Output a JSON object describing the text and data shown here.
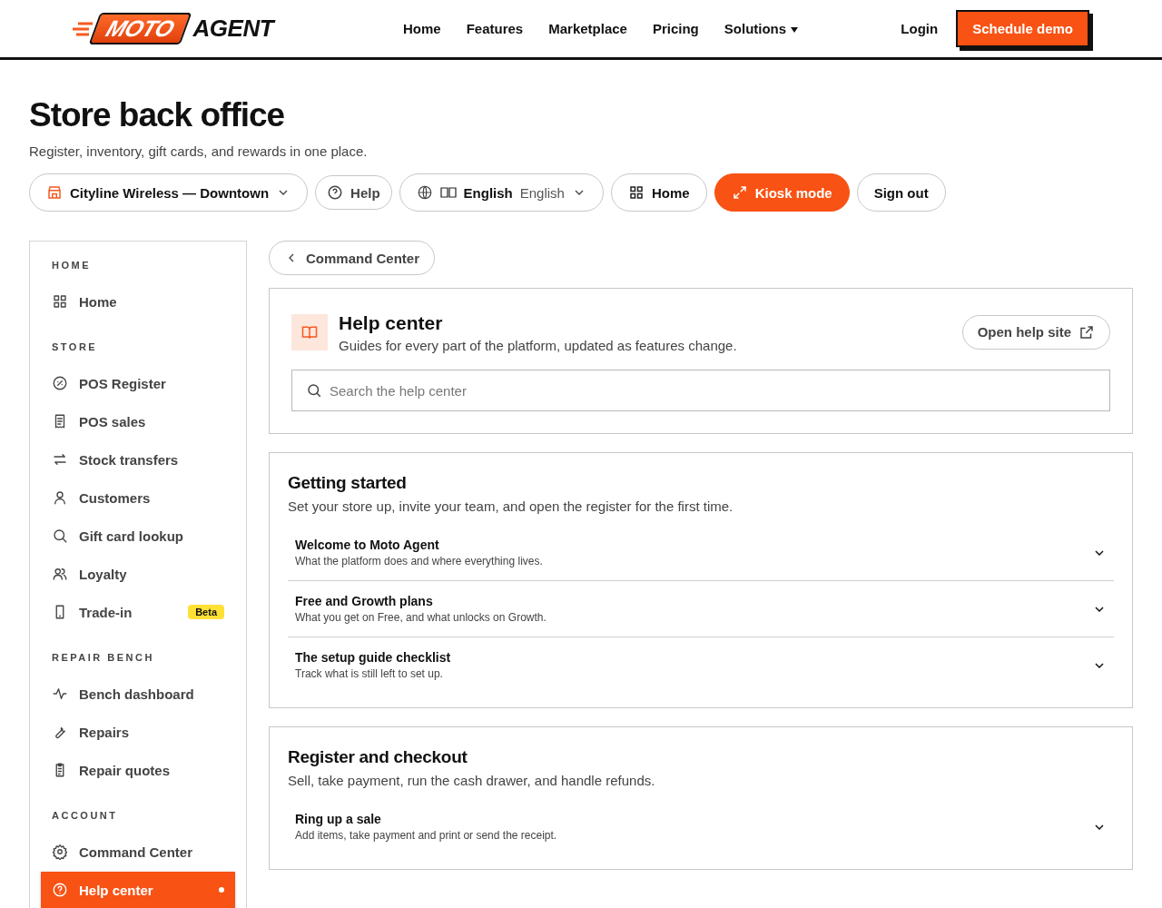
{
  "header": {
    "logo": {
      "word_1": "MOTO",
      "word_2": "AGENT"
    },
    "nav": [
      {
        "label": "Home",
        "dropdown": false
      },
      {
        "label": "Features",
        "dropdown": false
      },
      {
        "label": "Marketplace",
        "dropdown": false
      },
      {
        "label": "Pricing",
        "dropdown": false
      },
      {
        "label": "Solutions",
        "dropdown": true
      }
    ],
    "login": "Login",
    "cta": "Schedule demo"
  },
  "page": {
    "title": "Store back office",
    "subtitle": "Register, inventory, gift cards, and rewards in one place."
  },
  "toolbar": {
    "store": "Cityline Wireless — Downtown",
    "help": "Help",
    "language": {
      "label": "English",
      "native": "English"
    },
    "home": "Home",
    "kiosk": "Kiosk mode",
    "sign_out": "Sign out"
  },
  "sidebar": [
    {
      "heading": "HOME",
      "items": [
        {
          "label": "Home",
          "selected": false
        }
      ]
    },
    {
      "heading": "STORE",
      "items": [
        {
          "label": "POS Register",
          "selected": false
        },
        {
          "label": "POS sales",
          "selected": false
        },
        {
          "label": "Stock transfers",
          "selected": false
        },
        {
          "label": "Customers",
          "selected": false
        },
        {
          "label": "Gift card lookup",
          "selected": false
        },
        {
          "label": "Loyalty",
          "selected": false
        },
        {
          "label": "Trade-in",
          "selected": false,
          "badge": "Beta"
        }
      ]
    },
    {
      "heading": "REPAIR BENCH",
      "items": [
        {
          "label": "Bench dashboard",
          "selected": false
        },
        {
          "label": "Repairs",
          "selected": false
        },
        {
          "label": "Repair quotes",
          "selected": false
        }
      ]
    },
    {
      "heading": "ACCOUNT",
      "items": [
        {
          "label": "Command Center",
          "selected": false
        },
        {
          "label": "Help center",
          "selected": true
        }
      ]
    }
  ],
  "back_link": "Command Center",
  "help_card": {
    "title": "Help center",
    "subtitle": "Guides for every part of the platform, updated as features change.",
    "button": "Open help site",
    "search_placeholder": "Search the help center"
  },
  "sections": [
    {
      "title": "Getting started",
      "subtitle": "Set your store up, invite your team, and open the register for the first time.",
      "items": [
        {
          "title": "Welcome to Moto Agent",
          "description": "What the platform does and where everything lives.",
          "expanded": false
        },
        {
          "title": "Free and Growth plans",
          "description": "What you get on Free, and what unlocks on Growth.",
          "expanded": false
        },
        {
          "title": "The setup guide checklist",
          "description": "Track what is still left to set up.",
          "expanded": false
        }
      ]
    },
    {
      "title": "Register and checkout",
      "subtitle": "Sell, take payment, run the cash drawer, and handle refunds.",
      "items": [
        {
          "title": "Ring up a sale",
          "description": "Add items, take payment and print or send the receipt.",
          "expanded": false
        }
      ]
    }
  ]
}
